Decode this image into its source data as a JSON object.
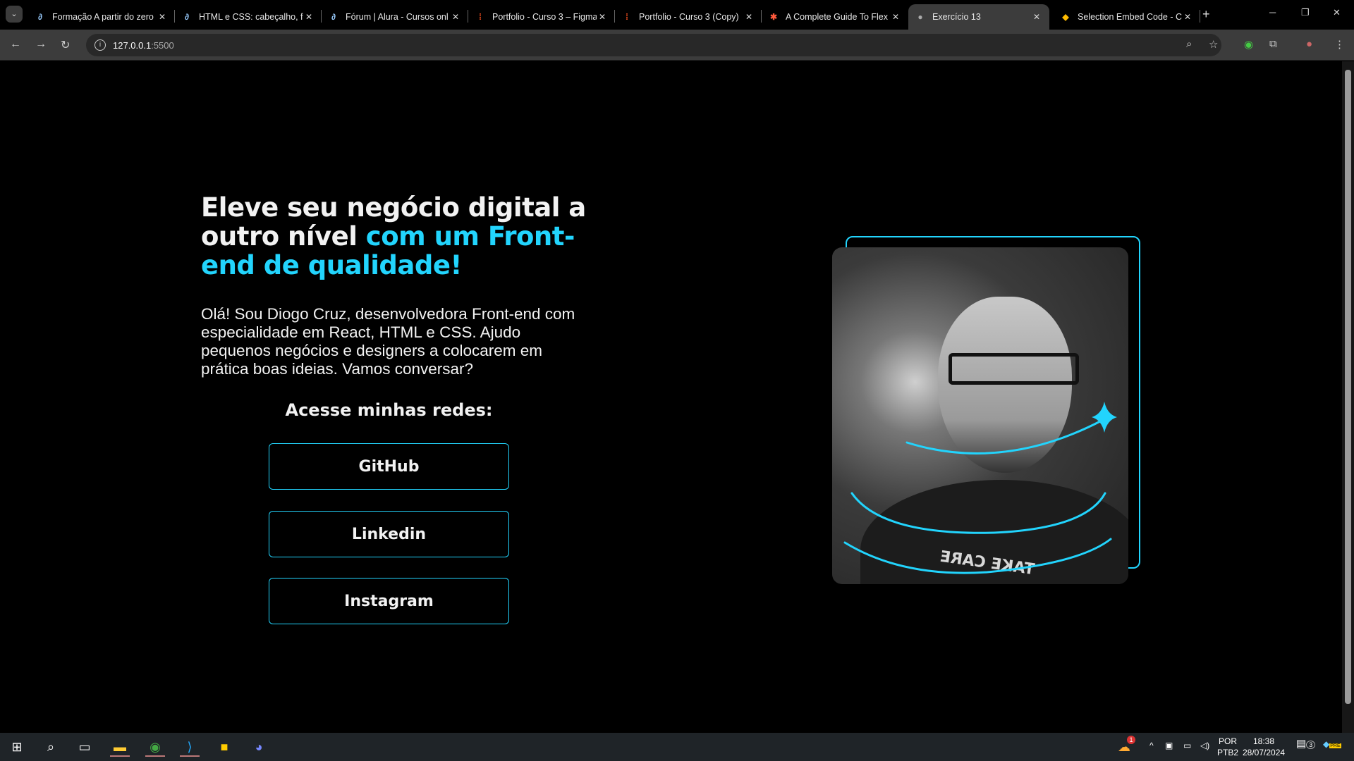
{
  "browser": {
    "tabs": [
      {
        "title": "Formação A partir do zero",
        "icon": "alura-icon"
      },
      {
        "title": "HTML e CSS: cabeçalho, fo",
        "icon": "alura-icon"
      },
      {
        "title": "Fórum | Alura - Cursos onl",
        "icon": "alura-icon"
      },
      {
        "title": "Portfolio - Curso 3 – Figma",
        "icon": "figma-icon"
      },
      {
        "title": "Portfolio - Curso 3 (Copy)",
        "icon": "figma-icon"
      },
      {
        "title": "A Complete Guide To Flex",
        "icon": "css-tricks-icon"
      },
      {
        "title": "Exercício 13",
        "icon": "globe-icon",
        "active": true
      },
      {
        "title": "Selection Embed Code - C",
        "icon": "selection-icon"
      }
    ],
    "url_host": "127.0.0.1",
    "url_port": ":5500"
  },
  "page": {
    "heading_white": "Eleve seu negócio digital a outro nível ",
    "heading_accent": "com um Front-end de qualidade!",
    "paragraph": "Olá! Sou Diogo Cruz, desenvolvedora Front-end com especialidade em React, HTML e CSS. Ajudo pequenos negócios e designers a colocarem em prática boas ideias. Vamos conversar?",
    "social_title": "Acesse minhas redes:",
    "buttons": [
      "GitHub",
      "Linkedin",
      "Instagram"
    ],
    "shirt_text": "TAKE CARE",
    "accent_color": "#22d4fd"
  },
  "taskbar": {
    "weather_badge": "1",
    "lang_top": "POR",
    "lang_bottom": "PTB2",
    "time": "18:38",
    "date": "28/07/2024",
    "notif_count": "3",
    "copilot_badge": "PRE"
  }
}
